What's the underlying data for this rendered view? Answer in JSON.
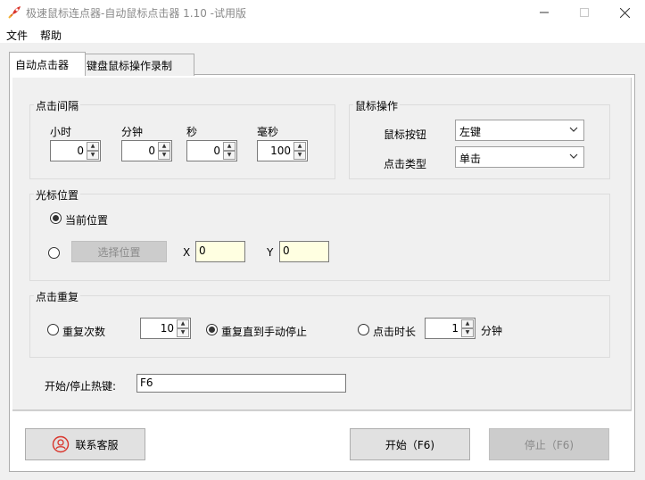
{
  "window": {
    "title": "极速鼠标连点器-自动鼠标点击器 1.10  -试用版"
  },
  "menu": {
    "file": "文件",
    "help": "帮助"
  },
  "tabs": {
    "autoclicker": "自动点击器",
    "recorder": "键盘鼠标操作录制"
  },
  "interval": {
    "title": "点击间隔",
    "hours_label": "小时",
    "hours_value": "0",
    "minutes_label": "分钟",
    "minutes_value": "0",
    "seconds_label": "秒",
    "seconds_value": "0",
    "ms_label": "毫秒",
    "ms_value": "100"
  },
  "mouse_action": {
    "title": "鼠标操作",
    "button_label": "鼠标按钮",
    "button_value": "左键",
    "click_type_label": "点击类型",
    "click_type_value": "单击"
  },
  "cursor": {
    "title": "光标位置",
    "current_position": "当前位置",
    "choose_position": "选择位置",
    "x_label": "X",
    "x_value": "0",
    "y_label": "Y",
    "y_value": "0"
  },
  "repeat": {
    "title": "点击重复",
    "repeat_times": "重复次数",
    "repeat_count_value": "10",
    "repeat_until_stop": "重复直到手动停止",
    "click_duration": "点击时长",
    "duration_value": "1",
    "duration_unit": "分钟"
  },
  "hotkey": {
    "label": "开始/停止热键:",
    "value": "F6"
  },
  "footer": {
    "contact": "联系客服",
    "start": "开始（F6)",
    "stop": "停止（F6)"
  },
  "colors": {
    "accent_icon": "#d9342b",
    "input_highlight": "#ffffe1"
  }
}
